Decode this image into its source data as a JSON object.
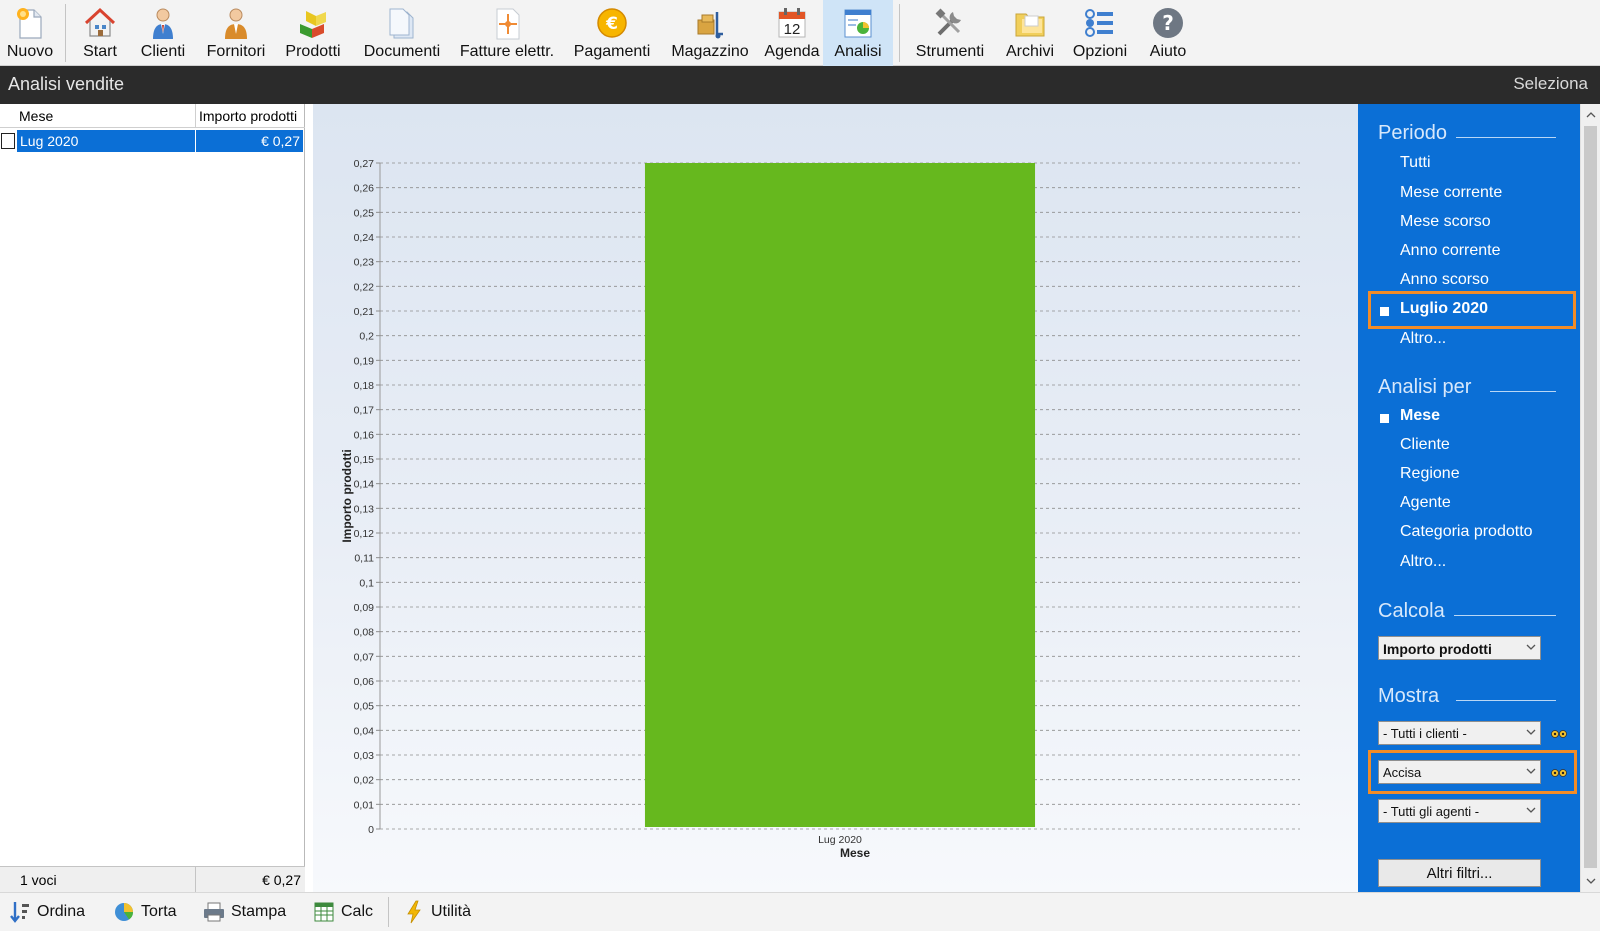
{
  "toolbar": {
    "items": [
      {
        "label": "Nuovo",
        "icon": "new-document-icon"
      },
      {
        "label": "Start",
        "icon": "home-icon"
      },
      {
        "label": "Clienti",
        "icon": "customer-icon"
      },
      {
        "label": "Fornitori",
        "icon": "supplier-icon"
      },
      {
        "label": "Prodotti",
        "icon": "products-icon"
      },
      {
        "label": "Documenti",
        "icon": "documents-icon"
      },
      {
        "label": "Fatture elettr.",
        "icon": "e-invoice-icon"
      },
      {
        "label": "Pagamenti",
        "icon": "euro-coin-icon"
      },
      {
        "label": "Magazzino",
        "icon": "warehouse-icon"
      },
      {
        "label": "Agenda",
        "icon": "calendar-icon",
        "calendar_day": "12"
      },
      {
        "label": "Analisi",
        "icon": "analysis-chart-icon",
        "active": true
      },
      {
        "label": "Strumenti",
        "icon": "tools-icon"
      },
      {
        "label": "Archivi",
        "icon": "folders-icon"
      },
      {
        "label": "Opzioni",
        "icon": "options-list-icon"
      },
      {
        "label": "Aiuto",
        "icon": "help-icon"
      }
    ]
  },
  "titlebar": {
    "title": "Analisi vendite",
    "select_label": "Seleziona"
  },
  "grid": {
    "columns": [
      "Mese",
      "Importo prodotti"
    ],
    "rows": [
      {
        "mese": "Lug 2020",
        "importo": "€ 0,27",
        "selected": true
      }
    ],
    "footer": {
      "count": "1 voci",
      "total": "€ 0,27"
    }
  },
  "chart_data": {
    "type": "bar",
    "categories": [
      "Lug 2020"
    ],
    "values": [
      0.27
    ],
    "xlabel": "Mese",
    "ylabel": "Importo prodotti",
    "ylim": [
      0,
      0.27
    ],
    "ytick_step": 0.01,
    "ytick_labels": [
      "0",
      "0,01",
      "0,02",
      "0,03",
      "0,04",
      "0,05",
      "0,06",
      "0,07",
      "0,08",
      "0,09",
      "0,1",
      "0,11",
      "0,12",
      "0,13",
      "0,14",
      "0,15",
      "0,16",
      "0,17",
      "0,18",
      "0,19",
      "0,2",
      "0,21",
      "0,22",
      "0,23",
      "0,24",
      "0,25",
      "0,26",
      "0,27"
    ],
    "grid": true,
    "bar_color": "#66b81e"
  },
  "panel": {
    "periodo": {
      "title": "Periodo",
      "options": [
        "Tutti",
        "Mese corrente",
        "Mese scorso",
        "Anno corrente",
        "Anno scorso",
        "Luglio 2020",
        "Altro..."
      ],
      "selected": "Luglio 2020"
    },
    "analisi_per": {
      "title": "Analisi per",
      "options": [
        "Mese",
        "Cliente",
        "Regione",
        "Agente",
        "Categoria prodotto",
        "Altro..."
      ],
      "selected": "Mese"
    },
    "calcola": {
      "title": "Calcola",
      "value": "Importo prodotti"
    },
    "mostra": {
      "title": "Mostra",
      "clienti": "-  Tutti i clienti  -",
      "prodotto_filter": "Accisa",
      "agenti": "-  Tutti gli agenti  -"
    },
    "altri_filtri": "Altri filtri...",
    "highlight_color": "#f28c28",
    "background_color": "#0b6fd6"
  },
  "bottombar": {
    "items": [
      {
        "label": "Ordina",
        "icon": "sort-icon"
      },
      {
        "label": "Torta",
        "icon": "pie-chart-icon"
      },
      {
        "label": "Stampa",
        "icon": "printer-icon"
      },
      {
        "label": "Calc",
        "icon": "calc-spreadsheet-icon"
      },
      {
        "label": "Utilità",
        "icon": "lightning-icon"
      }
    ]
  }
}
